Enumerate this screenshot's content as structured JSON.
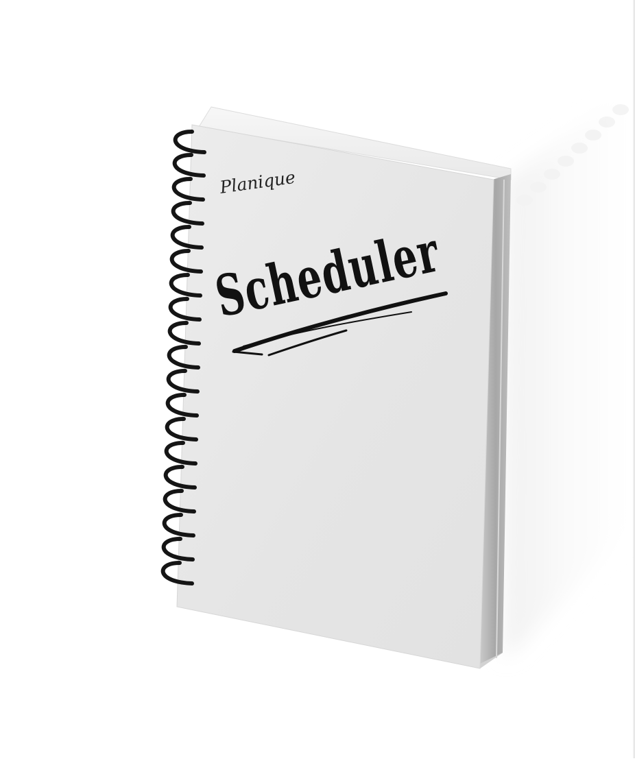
{
  "notebook": {
    "brand_text": "Planique",
    "title_text": "Scheduler"
  },
  "colors": {
    "background": "#ffffff",
    "cover": "#e6e6e6",
    "cover_highlight": "#efefef",
    "spine_side": "#a9a9a9",
    "coil": "#141414",
    "ink": "#111111",
    "shadow": "#eeeeee"
  }
}
